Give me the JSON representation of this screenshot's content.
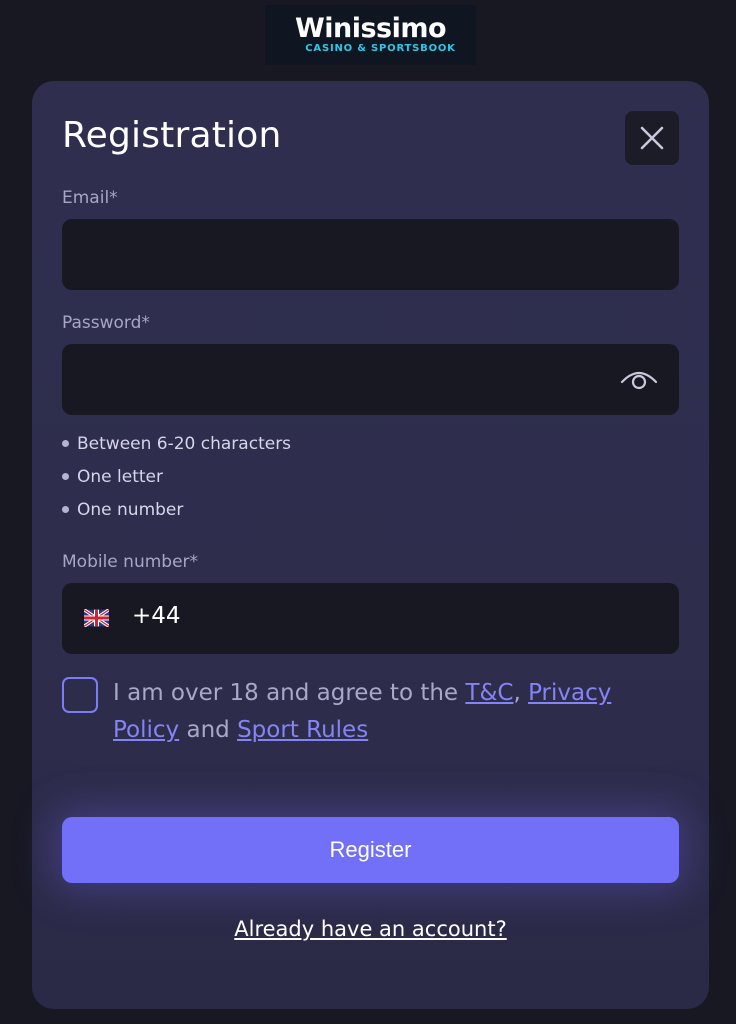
{
  "brand": {
    "name": "Winissimo",
    "tagline": "CASINO & SPORTSBOOK"
  },
  "modal": {
    "title": "Registration",
    "close_icon": "close-icon"
  },
  "email": {
    "label": "Email*",
    "value": "",
    "placeholder": ""
  },
  "password": {
    "label": "Password*",
    "value": "",
    "placeholder": "",
    "toggle_icon": "eye-icon",
    "rules": [
      "Between 6-20 characters",
      "One letter",
      "One number"
    ]
  },
  "mobile": {
    "label": "Mobile number*",
    "flag_icon": "uk-flag-icon",
    "prefix": "+44",
    "value": ""
  },
  "consent": {
    "checked": false,
    "text_before": "I am over 18 and agree to the ",
    "tc_link": "T&C",
    "separator": ", ",
    "privacy_link": "Privacy Policy",
    "and_text": " and ",
    "sport_rules_link": "Sport Rules"
  },
  "actions": {
    "register_label": "Register",
    "login_link": "Already have an account?"
  },
  "colors": {
    "page_bg": "#171822",
    "modal_bg": "#2f2e4f",
    "input_bg": "#181822",
    "accent": "#7270f8",
    "link": "#8584f4"
  }
}
